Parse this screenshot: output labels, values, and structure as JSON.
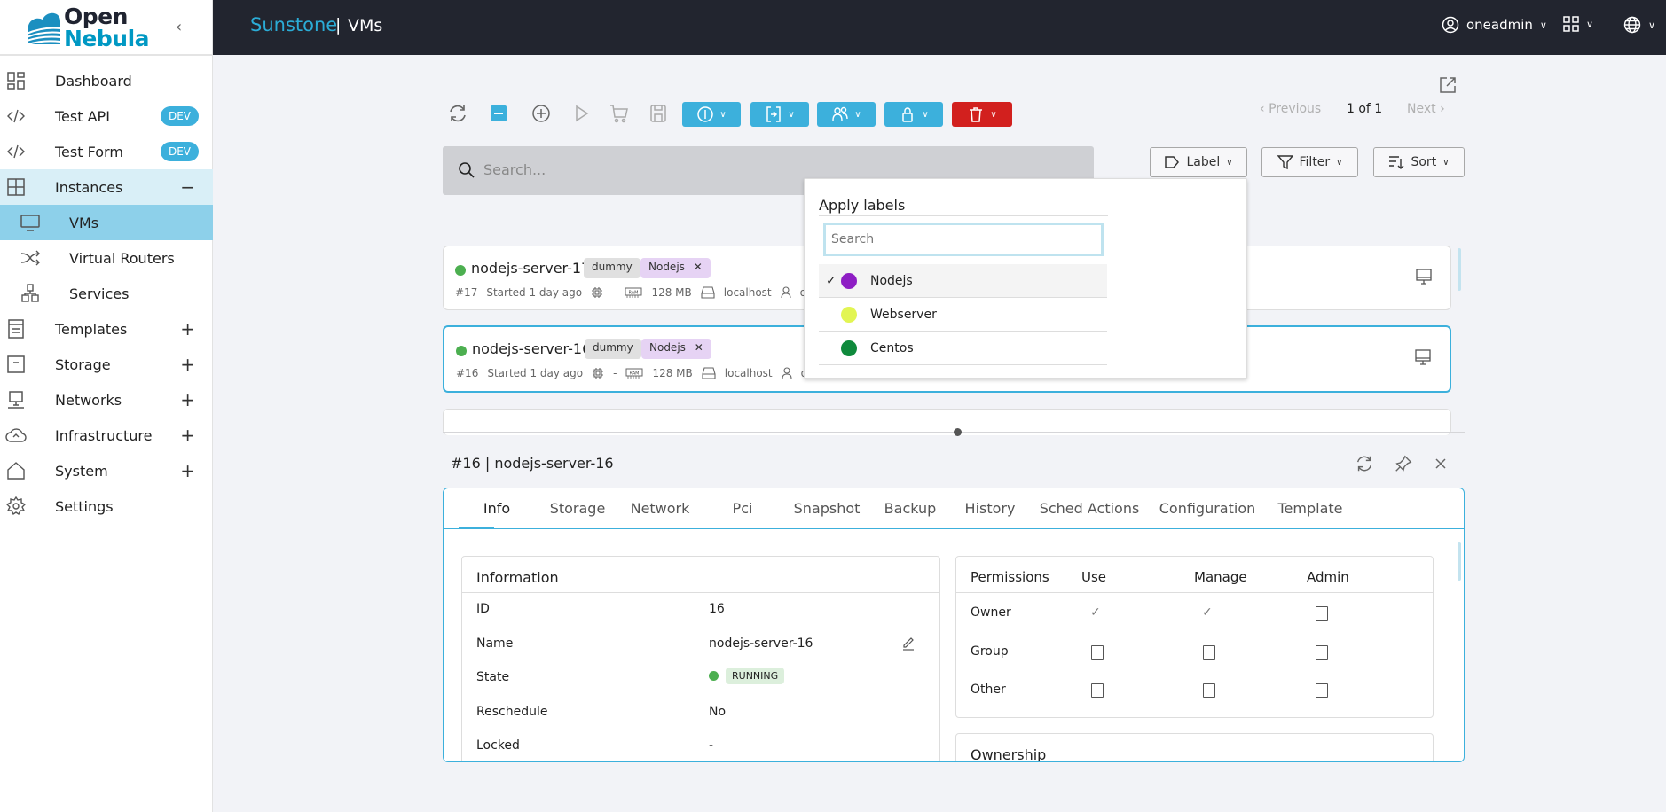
{
  "logo": {
    "line1": "Open",
    "line2": "Nebula"
  },
  "header": {
    "brand": "Sunstone",
    "separator": "|",
    "page": "VMs",
    "user": "oneadmin"
  },
  "sidebar": {
    "items": [
      {
        "label": "Dashboard",
        "icon": "dashboard-icon"
      },
      {
        "label": "Test API",
        "icon": "code-icon",
        "badge": "DEV"
      },
      {
        "label": "Test Form",
        "icon": "code-icon",
        "badge": "DEV"
      },
      {
        "label": "Instances",
        "icon": "instances-icon",
        "toggle": "−",
        "expanded": true
      },
      {
        "label": "VMs",
        "icon": "monitor-icon",
        "sub": true,
        "active": true
      },
      {
        "label": "Virtual Routers",
        "icon": "shuffle-icon",
        "sub": true
      },
      {
        "label": "Services",
        "icon": "services-icon",
        "sub": true
      },
      {
        "label": "Templates",
        "icon": "templates-icon",
        "toggle": "+"
      },
      {
        "label": "Storage",
        "icon": "storage-icon",
        "toggle": "+"
      },
      {
        "label": "Networks",
        "icon": "network-icon",
        "toggle": "+"
      },
      {
        "label": "Infrastructure",
        "icon": "cloud-icon",
        "toggle": "+"
      },
      {
        "label": "System",
        "icon": "home-icon",
        "toggle": "+"
      },
      {
        "label": "Settings",
        "icon": "gear-icon"
      }
    ]
  },
  "pagination": {
    "previous": "Previous",
    "current": "1 of 1",
    "next": "Next"
  },
  "search": {
    "placeholder": "Search..."
  },
  "filters": {
    "label": "Label",
    "filter": "Filter",
    "sort": "Sort"
  },
  "vms": [
    {
      "name": "nodejs-server-17",
      "id": "#17",
      "started": "Started 1 day ago",
      "cpu": "-",
      "ram": "128 MB",
      "host": "localhost",
      "owner": "onea",
      "labels": [
        "dummy",
        "Nodejs"
      ],
      "selected": false
    },
    {
      "name": "nodejs-server-16",
      "id": "#16",
      "started": "Started 1 day ago",
      "cpu": "-",
      "ram": "128 MB",
      "host": "localhost",
      "owner": "onea",
      "labels": [
        "dummy",
        "Nodejs"
      ],
      "selected": true
    }
  ],
  "label_menu": {
    "title": "Apply labels",
    "search_placeholder": "Search",
    "options": [
      {
        "name": "Nodejs",
        "color": "#8e1ec4",
        "checked": true
      },
      {
        "name": "Webserver",
        "color": "#e2f553",
        "checked": false
      },
      {
        "name": "Centos",
        "color": "#0f8a3c",
        "checked": false
      }
    ]
  },
  "detail": {
    "title": "#16 | nodejs-server-16",
    "tabs": [
      "Info",
      "Storage",
      "Network",
      "Pci",
      "Snapshot",
      "Backup",
      "History",
      "Sched Actions",
      "Configuration",
      "Template"
    ],
    "active_tab": "Info",
    "information": {
      "title": "Information",
      "rows": [
        {
          "label": "ID",
          "value": "16"
        },
        {
          "label": "Name",
          "value": "nodejs-server-16"
        },
        {
          "label": "State",
          "value": "RUNNING"
        },
        {
          "label": "Reschedule",
          "value": "No"
        },
        {
          "label": "Locked",
          "value": "-"
        }
      ]
    },
    "permissions": {
      "headers": [
        "Permissions",
        "Use",
        "Manage",
        "Admin"
      ],
      "rows": [
        {
          "label": "Owner",
          "use": true,
          "manage": true,
          "admin": false
        },
        {
          "label": "Group",
          "use": false,
          "manage": false,
          "admin": false
        },
        {
          "label": "Other",
          "use": false,
          "manage": false,
          "admin": false
        }
      ]
    },
    "ownership": {
      "title": "Ownership"
    }
  },
  "colors": {
    "accent": "#3cb0dc",
    "danger": "#d2201e",
    "header_bg": "#22252f",
    "running": "#4caf50"
  }
}
